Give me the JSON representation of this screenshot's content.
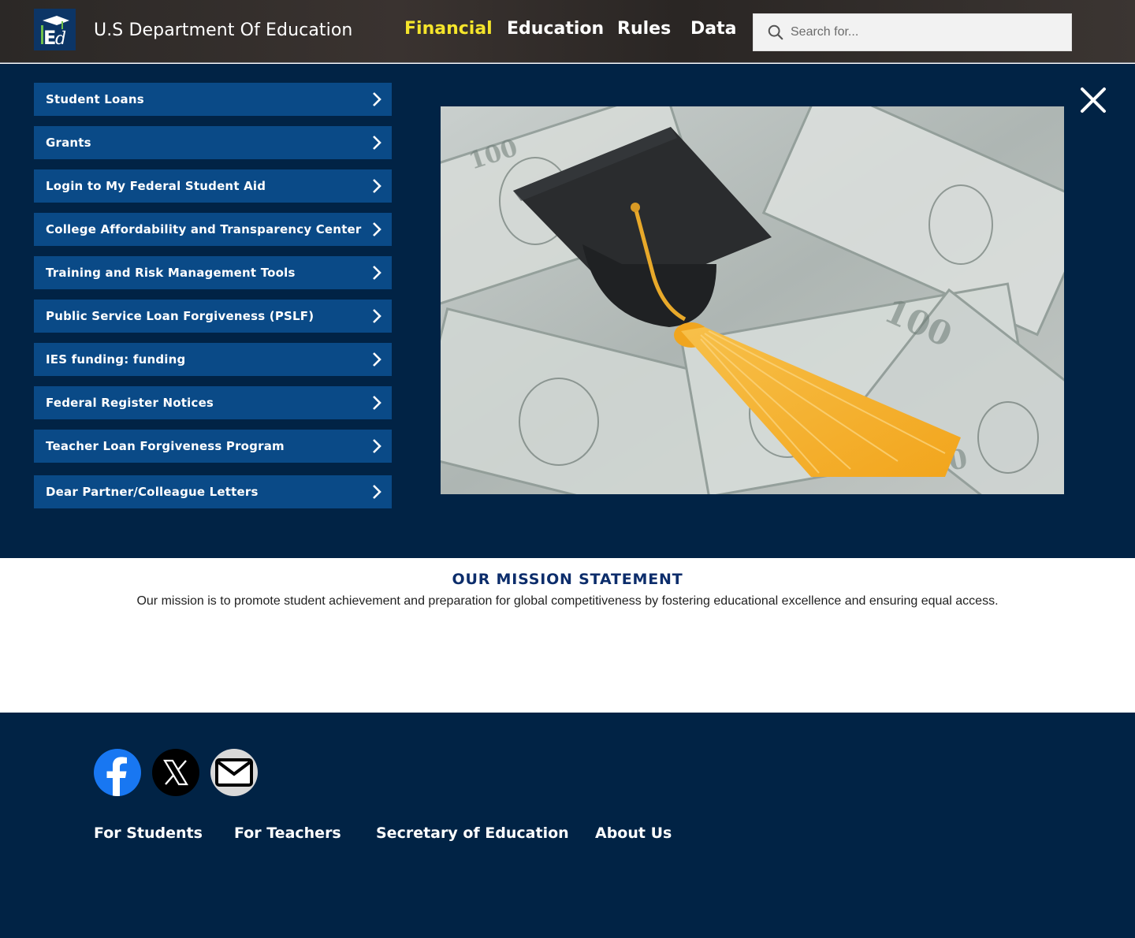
{
  "header": {
    "site_title": "U.S Department Of Education",
    "logo_icon": "graduation-cap-ed-logo",
    "nav": [
      {
        "label": "Financial",
        "active": true
      },
      {
        "label": "Education",
        "active": false
      },
      {
        "label": "Rules",
        "active": false
      },
      {
        "label": "Data",
        "active": false
      }
    ],
    "search": {
      "placeholder": "Search for...",
      "value": "",
      "icon": "search-icon"
    }
  },
  "mega_menu": {
    "items": [
      {
        "label": "Student Loans"
      },
      {
        "label": "Grants"
      },
      {
        "label": "Login to My Federal Student Aid"
      },
      {
        "label": "College Affordability and Transparency Center"
      },
      {
        "label": "Training and Risk Management Tools"
      },
      {
        "label": "Public Service Loan Forgiveness (PSLF)"
      },
      {
        "label": "IES funding: funding"
      },
      {
        "label": "Federal Register Notices"
      },
      {
        "label": "Teacher Loan Forgiveness Program"
      },
      {
        "label": "Dear Partner/Colleague Letters"
      }
    ],
    "close_icon": "close-icon",
    "hero_image": "graduation-cap-on-dollar-bills"
  },
  "mission": {
    "title": "OUR MISSION STATEMENT",
    "text": "Our mission is to promote student achievement and preparation for global competitiveness by fostering educational excellence and ensuring equal access."
  },
  "footer": {
    "social": [
      {
        "name": "facebook-icon"
      },
      {
        "name": "x-icon"
      },
      {
        "name": "email-icon"
      }
    ],
    "links": [
      {
        "label": "For Students"
      },
      {
        "label": "For Teachers"
      },
      {
        "label": "Secretary of Education"
      },
      {
        "label": "About Us"
      }
    ]
  },
  "colors": {
    "navy": "#012345",
    "menu_blue": "#0a4a87",
    "active_nav": "#f5e52b",
    "mission_title": "#0c2d6b",
    "facebook_blue": "#1877f2"
  }
}
